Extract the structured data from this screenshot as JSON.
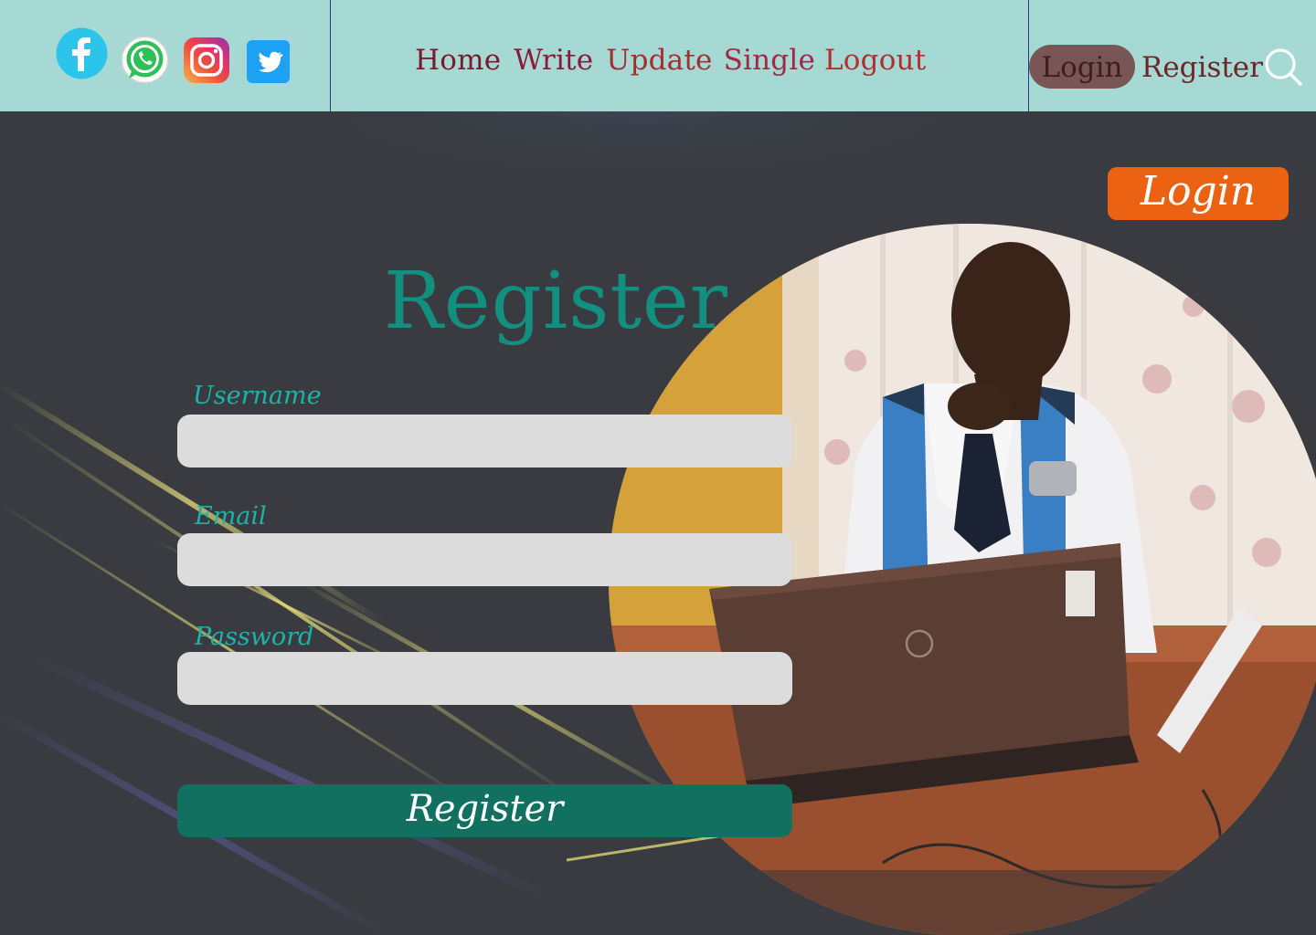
{
  "nav": {
    "social": [
      {
        "icon": "facebook-icon",
        "color": "#29c4e8"
      },
      {
        "icon": "whatsapp-icon",
        "color": "#25d366"
      },
      {
        "icon": "instagram-icon",
        "color": "#e1306c"
      },
      {
        "icon": "twitter-icon",
        "color": "#1da1f2"
      }
    ],
    "links": [
      {
        "label": "Home",
        "color": "#7a1a2a"
      },
      {
        "label": "Write",
        "color": "#8a1a3a"
      },
      {
        "label": "Update",
        "color": "#a0302f"
      },
      {
        "label": "Single",
        "color": "#a02a45"
      },
      {
        "label": "Logout",
        "color": "#b03030"
      }
    ],
    "login_label": "Login",
    "register_label": "Register"
  },
  "hero": {
    "login_button": "Login"
  },
  "form": {
    "title": "Register",
    "username_label": "Username",
    "username_value": "",
    "email_label": "Email",
    "email_value": "",
    "password_label": "Password",
    "password_value": "",
    "submit_label": "Register"
  },
  "colors": {
    "nav_bg": "#a6d8d4",
    "page_bg": "#393b40",
    "accent_orange": "#ea6212",
    "accent_teal": "#138f80",
    "submit_bg": "#117060"
  }
}
